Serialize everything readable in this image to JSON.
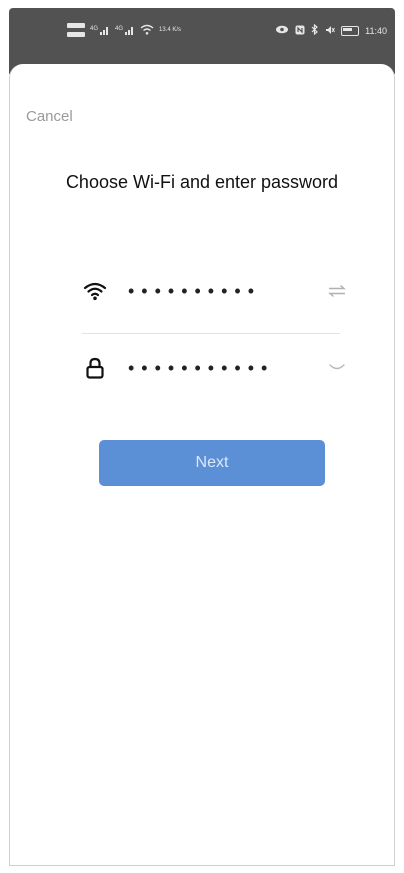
{
  "status_bar": {
    "network_speed": "13.4 K/s",
    "time": "11:40",
    "icons": [
      "sim-icon",
      "signal-icon",
      "signal-icon",
      "wifi-icon",
      "eye-icon",
      "nfc-icon",
      "bluetooth-icon",
      "mute-icon",
      "battery-icon"
    ]
  },
  "header": {
    "cancel_label": "Cancel",
    "title": "Choose Wi-Fi and enter password"
  },
  "form": {
    "wifi_field": {
      "value": "••••••••••",
      "lead_icon": "wifi-icon",
      "trail_icon": "switch-network-icon"
    },
    "password_field": {
      "value": "•••••••••••",
      "lead_icon": "lock-icon",
      "trail_icon": "eye-closed-icon"
    },
    "next_label": "Next"
  },
  "colors": {
    "accent": "#5b8fd6",
    "status_bar_bg": "#525252",
    "muted_text": "#9a9a9a"
  }
}
